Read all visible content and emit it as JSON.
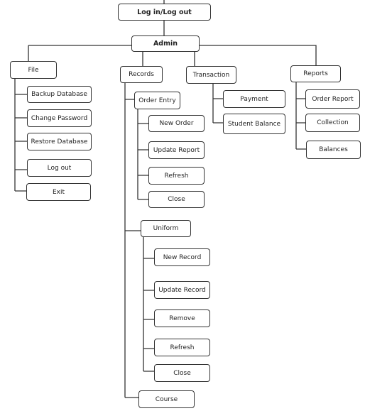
{
  "root": {
    "label": "Log in/Log out"
  },
  "admin": {
    "label": "Admin"
  },
  "file": {
    "label": "File",
    "items": [
      "Backup Database",
      "Change Password",
      "Restore Database",
      "Log out",
      "Exit"
    ]
  },
  "records": {
    "label": "Records",
    "order_entry": {
      "label": "Order Entry",
      "items": [
        "New Order",
        "Update Report",
        "Refresh",
        "Close"
      ]
    },
    "uniform": {
      "label": "Uniform",
      "items": [
        "New Record",
        "Update Record",
        "Remove",
        "Refresh",
        "Close"
      ]
    },
    "course": {
      "label": "Course"
    }
  },
  "transaction": {
    "label": "Transaction",
    "items": [
      "Payment",
      "Student Balance"
    ]
  },
  "reports": {
    "label": "Reports",
    "items": [
      "Order Report",
      "Collection",
      "Balances"
    ]
  }
}
